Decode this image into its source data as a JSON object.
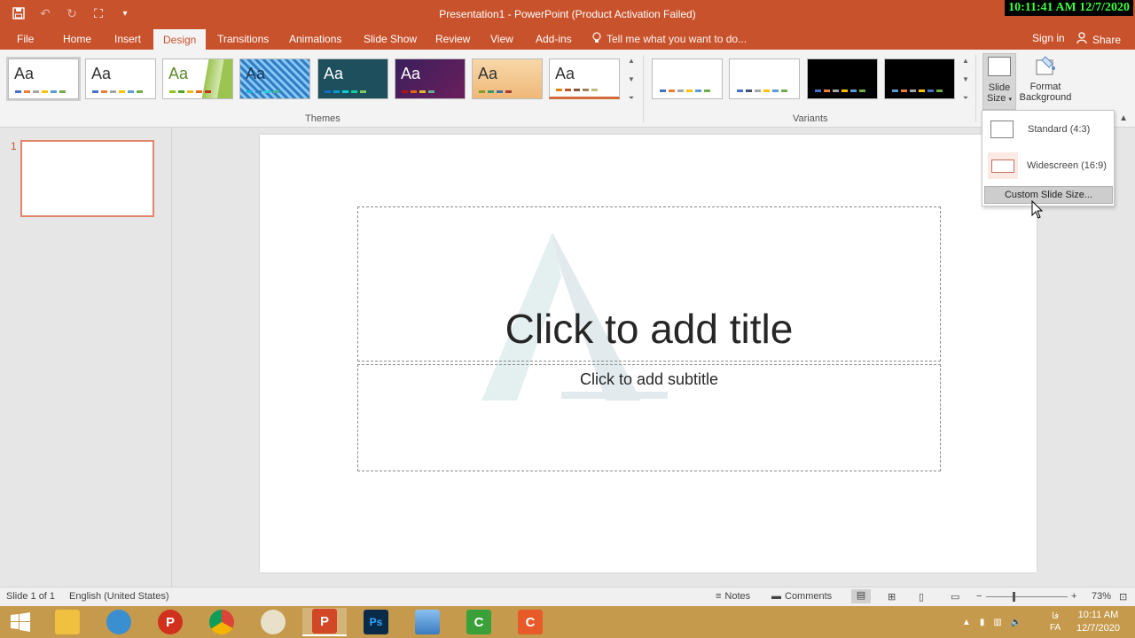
{
  "window": {
    "title": "Presentation1 - PowerPoint (Product Activation Failed)",
    "clock_overlay": "10:11:41 AM 12/7/2020"
  },
  "tabs": [
    {
      "label": "File"
    },
    {
      "label": "Home"
    },
    {
      "label": "Insert"
    },
    {
      "label": "Design",
      "active": true
    },
    {
      "label": "Transitions"
    },
    {
      "label": "Animations"
    },
    {
      "label": "Slide Show"
    },
    {
      "label": "Review"
    },
    {
      "label": "View"
    },
    {
      "label": "Add-ins"
    }
  ],
  "tell_me": "Tell me what you want to do...",
  "account": {
    "signin": "Sign in",
    "share": "Share"
  },
  "ribbon": {
    "themes_label": "Themes",
    "variants_label": "Variants",
    "theme_aa": "Aa",
    "slide_size": {
      "line1": "Slide",
      "line2": "Size"
    },
    "format_background": {
      "line1": "Format",
      "line2": "Background"
    }
  },
  "slide_size_menu": {
    "standard": "Standard (4:3)",
    "widescreen": "Widescreen (16:9)",
    "custom": "Custom Slide Size..."
  },
  "thumbnail": {
    "number": "1"
  },
  "slide": {
    "title_placeholder": "Click to add title",
    "subtitle_placeholder": "Click to add subtitle"
  },
  "status": {
    "slide_count": "Slide 1 of 1",
    "language": "English (United States)",
    "notes": "Notes",
    "comments": "Comments",
    "zoom": "73%"
  },
  "taskbar": {
    "lang_short": "FA",
    "lang_char": "فا",
    "time": "10:11 AM",
    "date": "12/7/2020"
  },
  "colors": {
    "accent": "#c8522c",
    "taskbar": "#c69a4c"
  }
}
